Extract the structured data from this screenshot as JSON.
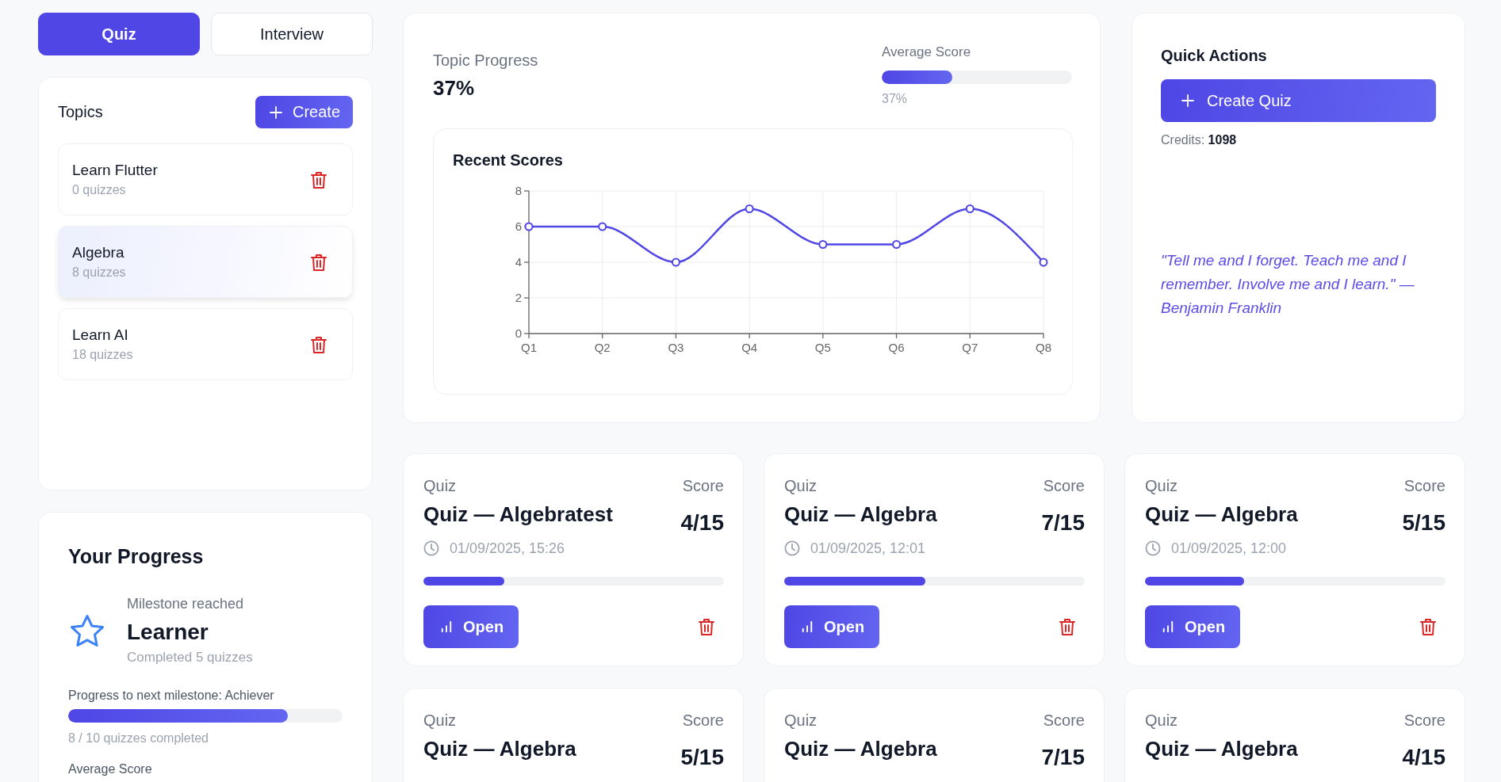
{
  "tabs": [
    {
      "label": "Quiz",
      "selected": true
    },
    {
      "label": "Interview",
      "selected": false
    }
  ],
  "topics": {
    "title": "Topics",
    "create_button": "Create",
    "items": [
      {
        "name": "Learn Flutter",
        "count": "0 quizzes",
        "selected": false
      },
      {
        "name": "Algebra",
        "count": "8 quizzes",
        "selected": true
      },
      {
        "name": "Learn AI",
        "count": "18 quizzes",
        "selected": false
      }
    ]
  },
  "your_progress": {
    "title": "Your Progress",
    "milestone_label": "Milestone reached",
    "milestone": "Learner",
    "milestone_detail": "Completed 5 quizzes",
    "next_label": "Progress to next milestone: Achiever",
    "level": 0.8,
    "caption": "8 / 10 quizzes completed",
    "average_label": "Average Score"
  },
  "overview": {
    "topic_progress": {
      "label": "Topic Progress",
      "value": "37%"
    },
    "average_score": {
      "label": "Average Score",
      "level": 0.37,
      "reading": "37%"
    },
    "chart_data": {
      "type": "line",
      "title": "Recent Scores",
      "categories": [
        "Q1",
        "Q2",
        "Q3",
        "Q4",
        "Q5",
        "Q6",
        "Q7",
        "Q8"
      ],
      "series": [
        {
          "color": "#4f46e5",
          "marker": "circle",
          "values": [
            6,
            6,
            4,
            7,
            5,
            5,
            7,
            4
          ]
        }
      ],
      "ylim": [
        0,
        8
      ],
      "yticks": [
        0,
        2,
        4,
        6,
        8
      ],
      "grid": true
    }
  },
  "quick_actions": {
    "title": "Quick Actions",
    "button": "Create Quiz",
    "credits": "Credits: **1098**",
    "quote": "\"Tell me and I forget. Teach me and I remember. Involve me and I learn.\" — Benjamin Franklin"
  },
  "quizzes": [
    {
      "label": "Quiz",
      "title": "Quiz — Algebratest",
      "score_label": "Score",
      "score": "4/15",
      "date": "01/09/2025, 15:26",
      "level": 0.27,
      "open_button": "Open"
    },
    {
      "label": "Quiz",
      "title": "Quiz — Algebra",
      "score_label": "Score",
      "score": "7/15",
      "date": "01/09/2025, 12:01",
      "level": 0.47,
      "open_button": "Open"
    },
    {
      "label": "Quiz",
      "title": "Quiz — Algebra",
      "score_label": "Score",
      "score": "5/15",
      "date": "01/09/2025, 12:00",
      "level": 0.33,
      "open_button": "Open"
    },
    {
      "label": "Quiz",
      "title": "Quiz — Algebra",
      "score_label": "Score",
      "score": "5/15"
    },
    {
      "label": "Quiz",
      "title": "Quiz — Algebra",
      "score_label": "Score",
      "score": "7/15"
    },
    {
      "label": "Quiz",
      "title": "Quiz — Algebra",
      "score_label": "Score",
      "score": "4/15"
    }
  ]
}
